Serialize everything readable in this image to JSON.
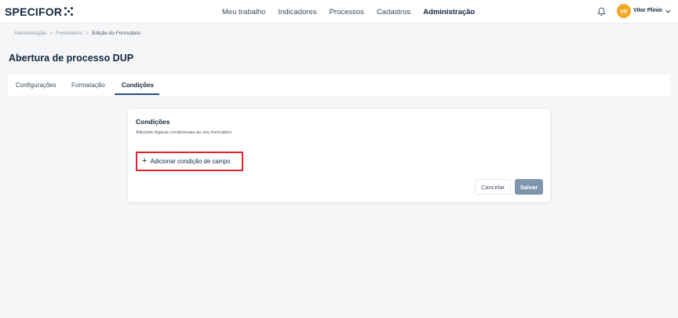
{
  "app": {
    "logo_text": "SPECIFOR",
    "nav": [
      {
        "label": "Meu trabalho",
        "active": false
      },
      {
        "label": "Indicadores",
        "active": false
      },
      {
        "label": "Processos",
        "active": false
      },
      {
        "label": "Cadastros",
        "active": false
      },
      {
        "label": "Administração",
        "active": true
      }
    ],
    "user": {
      "initials": "VP",
      "name": "Vitor Plinio",
      "avatar_color": "#f4a623"
    },
    "icons": {
      "bell": "bell-icon",
      "chevron": "chevron-down-icon",
      "plus": "plus-icon"
    }
  },
  "breadcrumb": [
    "Administração",
    "Formulários",
    "Edição do Formulário"
  ],
  "breadcrumb_separator": ">",
  "page": {
    "title": "Abertura de processo DUP"
  },
  "tabs": [
    {
      "label": "Configurações",
      "active": false
    },
    {
      "label": "Formatação",
      "active": false
    },
    {
      "label": "Condições",
      "active": true
    }
  ],
  "card": {
    "title": "Condições",
    "subtitle": "Adicione lógicas condicionais ao seu formulário.",
    "add_button_icon": "+",
    "add_button_label": "Adicionar condição de campo",
    "cancel_label": "Cancelar",
    "save_label": "Salvar"
  },
  "colors": {
    "accent": "#1f4f8a",
    "save_button": "#7e96ad",
    "highlight_border": "#e5222b"
  }
}
